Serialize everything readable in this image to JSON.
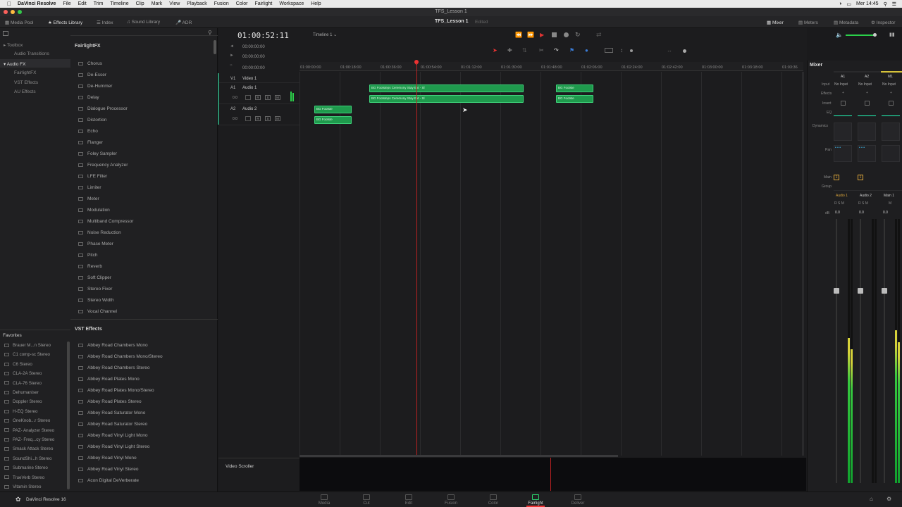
{
  "menubar": {
    "apple": "",
    "app": "DaVinci Resolve",
    "items": [
      "File",
      "Edit",
      "Trim",
      "Timeline",
      "Clip",
      "Mark",
      "View",
      "Playback",
      "Fusion",
      "Color",
      "Fairlight",
      "Workspace",
      "Help"
    ],
    "clock": "Mer 14:45"
  },
  "window": {
    "title": "TFS_Lesson 1"
  },
  "toolbar": {
    "media_pool": "Media Pool",
    "effects_library": "Effects Library",
    "index": "Index",
    "sound_library": "Sound Library",
    "adr": "ADR",
    "project_name": "TFS_Lesson 1",
    "status": "Edited",
    "mixer": "Mixer",
    "meters": "Meters",
    "metadata": "Metadata",
    "inspector": "Inspector"
  },
  "toolbox": {
    "root": "Toolbox",
    "audio_transitions": "Audio Transitions",
    "audio_fx": "Audio FX",
    "fairlight_fx": "FairlightFX",
    "vst_effects": "VST Effects",
    "au_effects": "AU Effects"
  },
  "fairlightfx": {
    "header": "FairlightFX",
    "items": [
      "Chorus",
      "De-Esser",
      "De-Hummer",
      "Delay",
      "Dialogue Processor",
      "Distortion",
      "Echo",
      "Flanger",
      "Foley Sampler",
      "Frequency Analyzer",
      "LFE Filter",
      "Limiter",
      "Meter",
      "Modulation",
      "Multiband Compressor",
      "Noise Reduction",
      "Phase Meter",
      "Pitch",
      "Reverb",
      "Soft Clipper",
      "Stereo Fixer",
      "Stereo Width",
      "Vocal Channel"
    ]
  },
  "vst": {
    "header": "VST Effects",
    "items": [
      "Abbey Road Chambers Mono",
      "Abbey Road Chambers Mono/Stereo",
      "Abbey Road Chambers Stereo",
      "Abbey Road Plates Mono",
      "Abbey Road Plates Mono/Stereo",
      "Abbey Road Plates Stereo",
      "Abbey Road Saturator Mono",
      "Abbey Road Saturator Stereo",
      "Abbey Road Vinyl Light Mono",
      "Abbey Road Vinyl Light Stereo",
      "Abbey Road Vinyl Mono",
      "Abbey Road Vinyl Stereo",
      "Acon Digital DeVerberate"
    ]
  },
  "favorites": {
    "header": "Favorites",
    "items": [
      "Brauer M...n Stereo",
      "C1 comp-sc Stereo",
      "C6 Stereo",
      "CLA-2A Stereo",
      "CLA-76 Stereo",
      "Dehumaniser",
      "Doppler Stereo",
      "H-EQ Stereo",
      "OneKnob...r Stereo",
      "PAZ- Analyzer Stereo",
      "PAZ- Freq...cy Stereo",
      "Smack Attack Stereo",
      "SoundShi...h Stereo",
      "Submarine Stereo",
      "TrueVerb Stereo",
      "Vitamin Stereo"
    ]
  },
  "timeline": {
    "timecode": "01:00:52:11",
    "name": "Timeline 1",
    "tc1": "00:00:00:00",
    "tc2": "00:00:00:00",
    "tc3": "00:00:00:00",
    "ruler": [
      "01:00:00:00",
      "01:00:18:00",
      "01:00:36:00",
      "01:00:54:00",
      "01:01:12:00",
      "01:01:30:00",
      "01:01:48:00",
      "01:02:06:00",
      "01:02:24:00",
      "01:02:42:00",
      "01:03:00:00",
      "01:03:18:00",
      "01:03:36"
    ],
    "tracks": [
      {
        "id": "V1",
        "name": "Video 1"
      },
      {
        "id": "A1",
        "name": "Audio 1",
        "level": "0.0"
      },
      {
        "id": "A2",
        "name": "Audio 2",
        "level": "0.0"
      }
    ],
    "track_buttons": [
      "R",
      "S",
      "M"
    ],
    "clips": {
      "a1_main_top": "BG Footsteps Ceremony Stay Ext - Sl",
      "a1_main_bottom": "BG Footsteps Ceremony Stay Ext - Sl",
      "a1_small_top": "BG Footste",
      "a1_small_bottom": "BG Footste",
      "a2_top": "BG Footste",
      "a2_bottom": "BG Footste"
    },
    "video_scroller": "Video Scroller"
  },
  "mixer": {
    "title": "Mixer",
    "channels": [
      "A1",
      "A2",
      "M1"
    ],
    "input_label": "Input",
    "input_value": "No Input",
    "effects_label": "Effects",
    "insert_label": "Insert",
    "eq_label": "EQ",
    "dynamics_label": "Dynamics",
    "pan_label": "Pan",
    "main_label": "Main",
    "group_label": "Group",
    "main_value": "1",
    "strip_names": [
      "Audio 1",
      "Audio 2",
      "Main 1"
    ],
    "rsm": [
      "R",
      "S",
      "M"
    ],
    "db_label": "dB",
    "fader_value": "0.0",
    "meter_levels": [
      0.55,
      0.0,
      0.58
    ]
  },
  "pages": [
    "Media",
    "Cut",
    "Edit",
    "Fusion",
    "Color",
    "Fairlight",
    "Deliver"
  ],
  "active_page": "Fairlight",
  "app_footer": "DaVinci Resolve 16"
}
